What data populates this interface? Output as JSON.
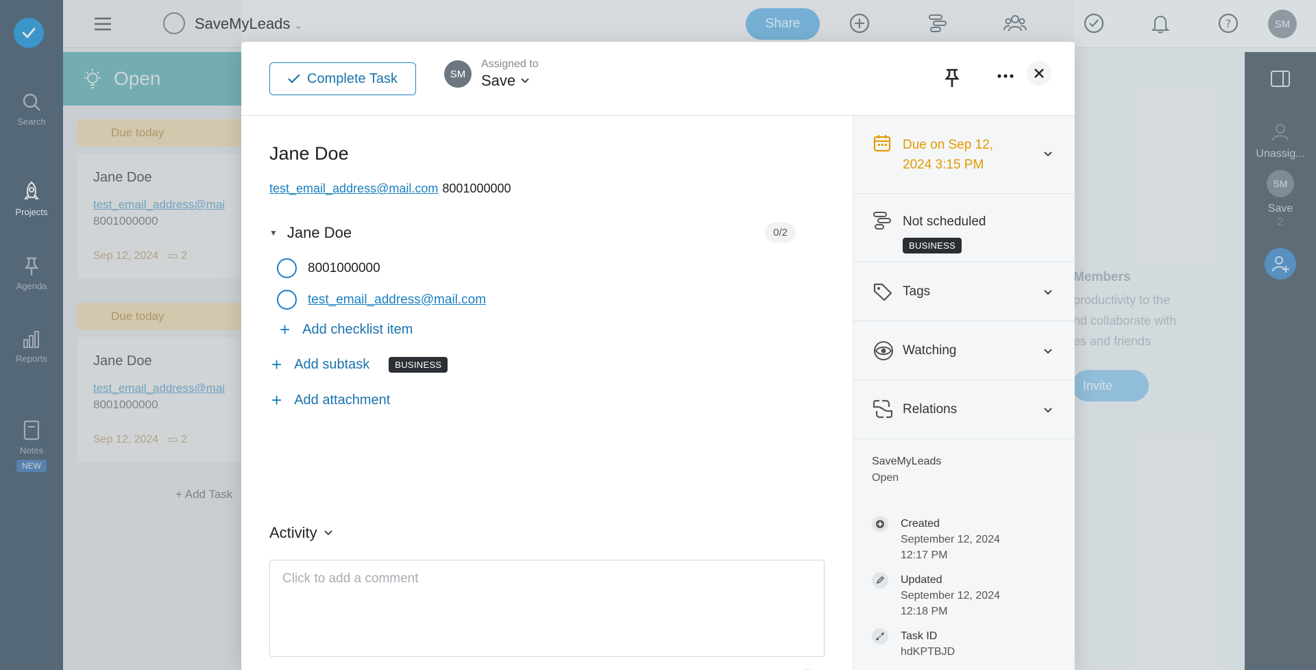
{
  "app": {
    "project_name": "SaveMyLeads",
    "share_label": "Share",
    "user_initials": "SM"
  },
  "leftnav": {
    "items": [
      {
        "label": "Search",
        "icon": "search-icon"
      },
      {
        "label": "Projects",
        "icon": "rocket-icon"
      },
      {
        "label": "Agenda",
        "icon": "pin-icon"
      },
      {
        "label": "Reports",
        "icon": "bar-chart-icon"
      },
      {
        "label": "Notes",
        "icon": "note-icon"
      }
    ],
    "notes_badge": "NEW"
  },
  "board": {
    "column_title": "Open",
    "due_today": "Due today",
    "cards": [
      {
        "name": "Jane Doe",
        "email": "test_email_address@mail.com",
        "phone": "8001000000",
        "date": "Sep 12, 2024",
        "comments": "2"
      },
      {
        "name": "Jane Doe",
        "email": "test_email_address@mail.com",
        "phone": "8001000000",
        "date": "Sep 12, 2024",
        "comments": "2"
      }
    ],
    "add_task": "Add Task"
  },
  "right_bg": {
    "unassigned": "Unassig...",
    "member_initials": "SM",
    "member_name": "Save",
    "member_count": "2",
    "members_heading": "Members",
    "members_line1": "productivity to the",
    "members_line2": "nd collaborate with",
    "members_line3": "es and friends",
    "invite_label": "Invite"
  },
  "modal": {
    "complete_label": "Complete Task",
    "assigned_label": "Assigned to",
    "assignee_initials": "SM",
    "assignee_name": "Save",
    "title": "Jane Doe",
    "email": "test_email_address@mail.com",
    "phone": "8001000000",
    "checklist": {
      "name": "Jane Doe",
      "count": "0/2",
      "items": [
        {
          "text": "8001000000"
        },
        {
          "text": "test_email_address@mail.com"
        }
      ],
      "add_label": "Add checklist item"
    },
    "add_subtask": "Add subtask",
    "subtask_tag": "BUSINESS",
    "add_attachment": "Add attachment",
    "activity_label": "Activity",
    "comment_placeholder": "Click to add a comment"
  },
  "sidebar": {
    "due": "Due on Sep 12, 2024 3:15 PM",
    "due_line1": "Due on Sep 12,",
    "due_line2": "2024 3:15 PM",
    "schedule": "Not scheduled",
    "schedule_tag": "BUSINESS",
    "tags": "Tags",
    "watching": "Watching",
    "relations": "Relations",
    "project": "SaveMyLeads",
    "status": "Open",
    "created_label": "Created",
    "created_date": "September 12, 2024",
    "created_time": "12:17 PM",
    "updated_label": "Updated",
    "updated_date": "September 12, 2024",
    "updated_time": "12:18 PM",
    "taskid_label": "Task ID",
    "taskid": "hdKPTBJD"
  },
  "colors": {
    "accent": "#1a80c1",
    "due": "#e39a00",
    "tag_bg": "#2b2f33"
  }
}
